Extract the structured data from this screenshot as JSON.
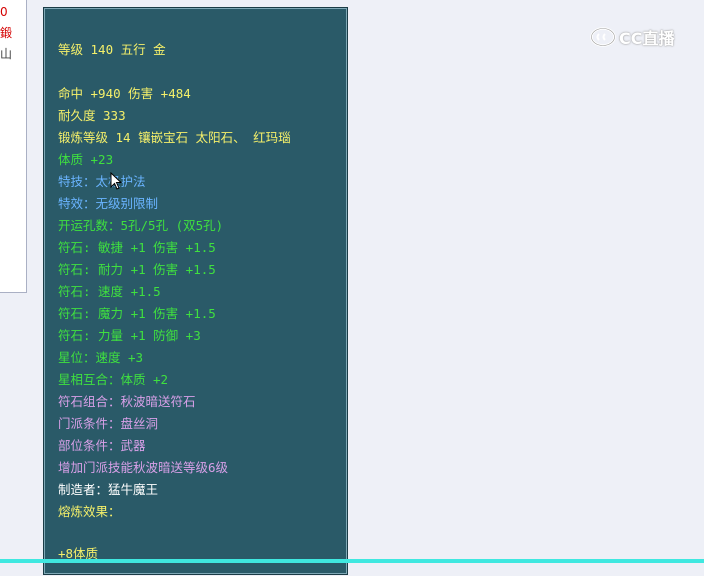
{
  "left_panel": {
    "lines": [
      {
        "text": "0",
        "color": "#d40000"
      },
      {
        "text": "鍛",
        "color": "#d40000"
      },
      {
        "text": "山",
        "color": "#444444"
      }
    ]
  },
  "tooltip": {
    "lines": [
      {
        "text": "等级 140 五行 金",
        "color": "#f5f06a"
      },
      {
        "text": "命中 +940 伤害 +484",
        "color": "#f5f06a"
      },
      {
        "text": "耐久度 333",
        "color": "#f5f06a"
      },
      {
        "text": "锻炼等级 14 镶嵌宝石 太阳石、 红玛瑙",
        "color": "#f5f06a"
      },
      {
        "text": "体质 +23",
        "color": "#3fe03f"
      },
      {
        "text": "特技：太极护法",
        "color": "#6ab4ff"
      },
      {
        "text": "特效：无级别限制",
        "color": "#6ab4ff"
      },
      {
        "text": "开运孔数：5孔/5孔 (双5孔)",
        "color": "#3fe03f"
      },
      {
        "text": "符石: 敏捷 +1 伤害 +1.5",
        "color": "#3fe03f"
      },
      {
        "text": "符石: 耐力 +1 伤害 +1.5",
        "color": "#3fe03f"
      },
      {
        "text": "符石: 速度 +1.5",
        "color": "#3fe03f"
      },
      {
        "text": "符石: 魔力 +1 伤害 +1.5",
        "color": "#3fe03f"
      },
      {
        "text": "符石: 力量 +1 防御 +3",
        "color": "#3fe03f"
      },
      {
        "text": "星位：速度 +3",
        "color": "#3fe03f"
      },
      {
        "text": "星相互合：体质 +2",
        "color": "#3fe03f"
      },
      {
        "text": "符石组合：秋波暗送符石",
        "color": "#d8a0e8"
      },
      {
        "text": "门派条件：盘丝洞",
        "color": "#d8a0e8"
      },
      {
        "text": "部位条件：武器",
        "color": "#d8a0e8"
      },
      {
        "text": "增加门派技能秋波暗送等级6级",
        "color": "#d8a0e8"
      },
      {
        "text": "制造者：猛牛魔王",
        "color": "#ffffff"
      },
      {
        "text": "熔炼效果：",
        "color": "#f5f06a"
      },
      {
        "text": "+8体质",
        "color": "#f5f06a"
      }
    ]
  },
  "watermark": {
    "text": "CC直播",
    "icon": "cc-logo-icon"
  }
}
